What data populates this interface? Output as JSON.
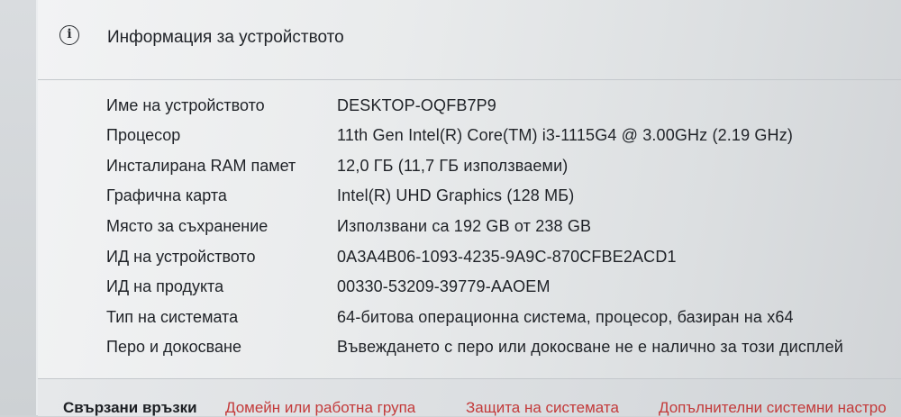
{
  "header": {
    "title": "Информация за устройството",
    "icon": "info-icon",
    "icon_glyph": "i"
  },
  "specs": [
    {
      "label": "Име на устройството",
      "value": "DESKTOP-OQFB7P9"
    },
    {
      "label": "Процесор",
      "value": "11th Gen Intel(R) Core(TM) i3-1115G4 @ 3.00GHz (2.19 GHz)"
    },
    {
      "label": "Инсталирана RAM памет",
      "value": "12,0 ГБ (11,7 ГБ използваеми)"
    },
    {
      "label": "Графична карта",
      "value": "Intel(R) UHD Graphics (128 МБ)"
    },
    {
      "label": "Място за съхранение",
      "value": "Използвани са 192 GB от 238 GB"
    },
    {
      "label": "ИД на устройството",
      "value": "0A3A4B06-1093-4235-9A9C-870CFBE2ACD1"
    },
    {
      "label": "ИД на продукта",
      "value": "00330-53209-39779-AAOEM"
    },
    {
      "label": "Тип на системата",
      "value": "64-битова операционна система, процесор, базиран на x64"
    },
    {
      "label": "Перо и докосване",
      "value": "Въвеждането с перо или докосване не е налично за този дисплей"
    }
  ],
  "footer": {
    "heading": "Свързани връзки",
    "links": [
      "Домейн или работна група",
      "Защита на системата",
      "Допълнителни системни настро"
    ]
  },
  "colors": {
    "link": "#c33a3a",
    "text": "#1f2227"
  }
}
